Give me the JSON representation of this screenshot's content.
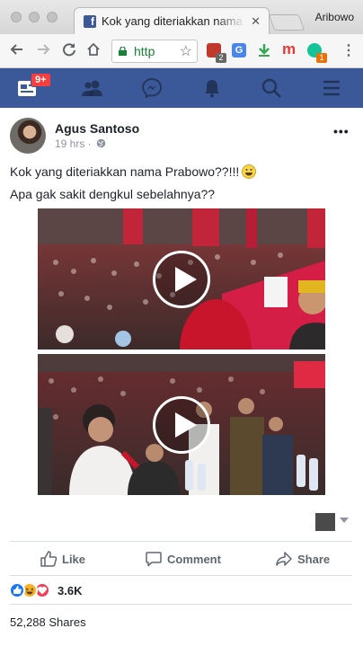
{
  "browser": {
    "tab_title": "Kok yang diteriakkan nama Prabowo",
    "tab_favicon": "f",
    "profile_name": "Aribowo",
    "url_display": "http",
    "extensions": [
      {
        "icon": "shield-icon",
        "color": "#c0392b",
        "badge": "2"
      },
      {
        "icon": "translate-icon",
        "color": "#4a86e8"
      },
      {
        "icon": "download-icon",
        "color": "#34a853"
      },
      {
        "icon": "m-icon",
        "color": "#e53935",
        "letter": "m"
      },
      {
        "icon": "grammarly-icon",
        "color": "#15c39a",
        "badge": "1"
      }
    ]
  },
  "fb_nav": {
    "bg_color": "#3b5998",
    "notification_count": "9+"
  },
  "post": {
    "author": "Agus Santoso",
    "time": "19 hrs ·",
    "text_line1": "Kok yang diteriakkan nama Prabowo??!!!",
    "text_line2": "Apa gak sakit dengkul sebelahnya??",
    "actions": {
      "like": "Like",
      "comment": "Comment",
      "share": "Share"
    },
    "reactions_count": "3.6K",
    "shares_text": "52,288 Shares"
  }
}
